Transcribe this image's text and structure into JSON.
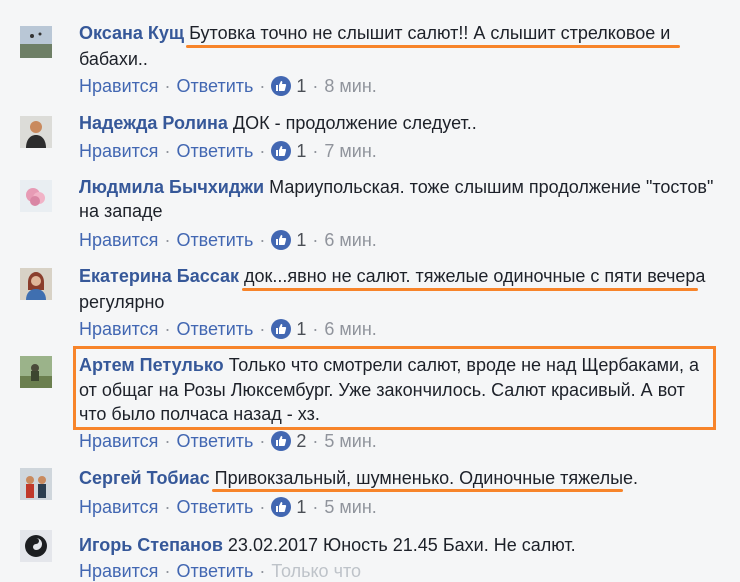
{
  "actions": {
    "like": "Нравится",
    "reply": "Ответить",
    "separator": "·"
  },
  "comments": [
    {
      "author": "Оксана Кущ",
      "lines": [
        "Бутовка точно не слышит салют!! А слышит стрелковое и",
        "бабахи.."
      ],
      "likes": "1",
      "time": "8 мин."
    },
    {
      "author": "Надежда Ролина",
      "lines": [
        "ДОК - продолжение следует..",
        ""
      ],
      "likes": "1",
      "time": "7 мин."
    },
    {
      "author": "Людмила Бычхиджи",
      "lines": [
        "Мариупольская. тоже слышим продолжение \"тостов\"",
        "на западе"
      ],
      "likes": "1",
      "time": "6 мин."
    },
    {
      "author": "Екатерина Бассак",
      "lines": [
        "док...явно не салют. тяжелые одиночные с пяти вечера",
        "регулярно"
      ],
      "likes": "1",
      "time": "6 мин."
    },
    {
      "author": "Артем Петулько",
      "lines": [
        "Только что смотрели салют, вроде не над Щербаками, а",
        "от общаг на Розы Люксембург. Уже закончилось. Салют красивый. А вот",
        "что было полчаса назад - хз."
      ],
      "likes": "2",
      "time": "5 мин."
    },
    {
      "author": "Сергей Тобиас",
      "lines": [
        "Привокзальный, шумненько. Одиночные тяжелые.",
        ""
      ],
      "likes": "1",
      "time": "5 мин."
    },
    {
      "author": "Игорь Степанов",
      "lines": [
        "23.02.2017 Юность 21.45 Бахи. Не салют."
      ],
      "likes": "",
      "time": "Только что"
    }
  ],
  "colors": {
    "accent": "#f7842a",
    "author": "#365899",
    "link": "#4267b2",
    "meta": "#90949c"
  }
}
